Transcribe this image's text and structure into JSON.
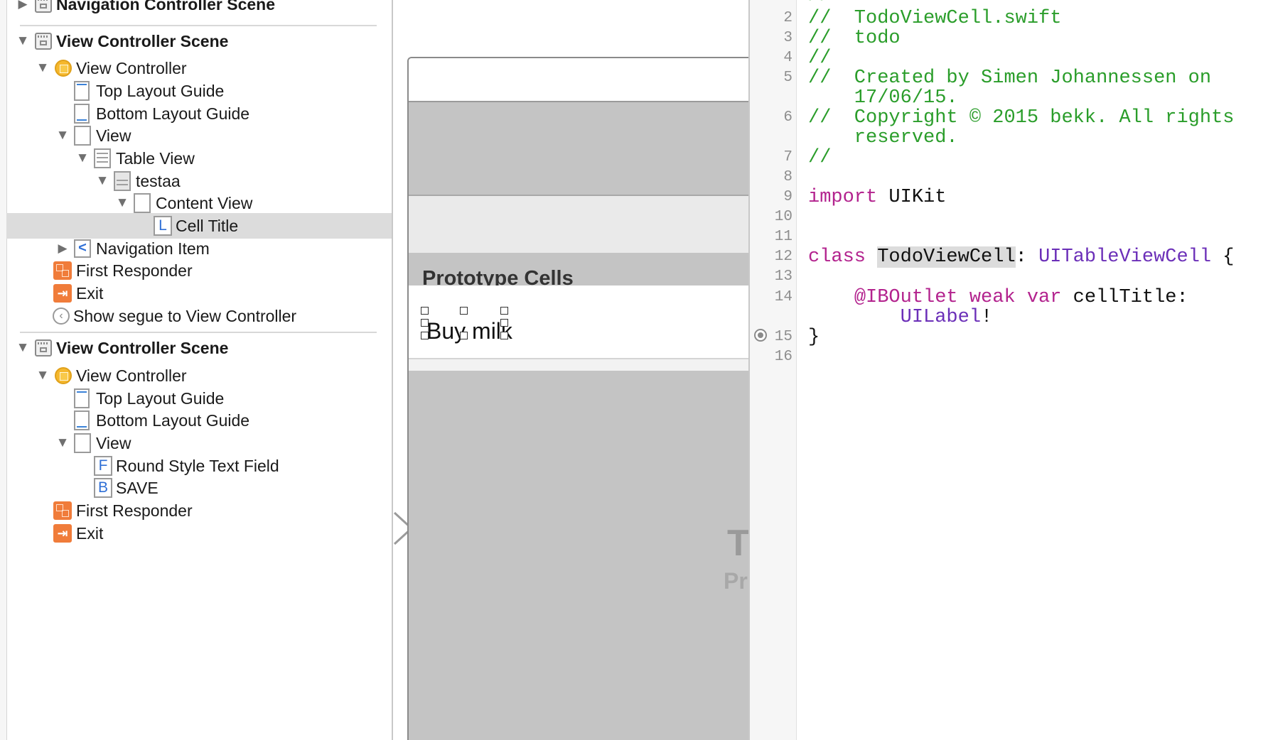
{
  "outline": {
    "scene_nav": "Navigation Controller Scene",
    "scene1": {
      "title": "View Controller Scene",
      "items": [
        "View Controller",
        "Top Layout Guide",
        "Bottom Layout Guide",
        "View",
        "Table View",
        "testaa",
        "Content View",
        "Cell Title",
        "Navigation Item",
        "First Responder",
        "Exit",
        "Show segue to View Controller"
      ]
    },
    "scene2": {
      "title": "View Controller Scene",
      "items": [
        "View Controller",
        "Top Layout Guide",
        "Bottom Layout Guide",
        "View",
        "Round Style Text Field",
        "SAVE",
        "First Responder",
        "Exit"
      ]
    },
    "icon_letters": {
      "label": "L",
      "text_field": "F",
      "button": "B",
      "nav_item": "<"
    },
    "selected_item": "Cell Title"
  },
  "canvas": {
    "section_header": "Prototype Cells",
    "cell_label": "Buy milk",
    "ghost_text_1": "T",
    "ghost_text_2": "Pr"
  },
  "editor": {
    "line_numbers": [
      "2",
      "3",
      "4",
      "5",
      "",
      "6",
      "",
      "7",
      "8",
      "9",
      "10",
      "11",
      "12",
      "13",
      "14",
      "",
      "15",
      "16"
    ],
    "lines": {
      "l2": "//  TodoViewCell.swift",
      "l3": "//  todo",
      "l4": "//",
      "l5a": "//  Created by Simen Johannessen on",
      "l5b": "    17/06/15.",
      "l6a": "//  Copyright © 2015 bekk. All rights",
      "l6b": "    reserved.",
      "l7": "//",
      "l9_kw": "import",
      "l9_rest": " UIKit",
      "l12_kw": "class",
      "l12_name": "TodoViewCell",
      "l12_colon": ": ",
      "l12_super": "UITableViewCell",
      "l12_brace": " {",
      "l14_attr": "@IBOutlet",
      "l14_kw": " weak var",
      "l14_rest": " cellTitle:",
      "l14b_type": "UILabel",
      "l14b_bang": "!",
      "l15": "}"
    }
  },
  "colors": {
    "comment": "#2a9d2a",
    "keyword": "#b3238e",
    "type": "#6b2fb8",
    "selection": "#dcdcdc",
    "icon_orange": "#f07c3a",
    "icon_yellow": "#f5b82e"
  }
}
